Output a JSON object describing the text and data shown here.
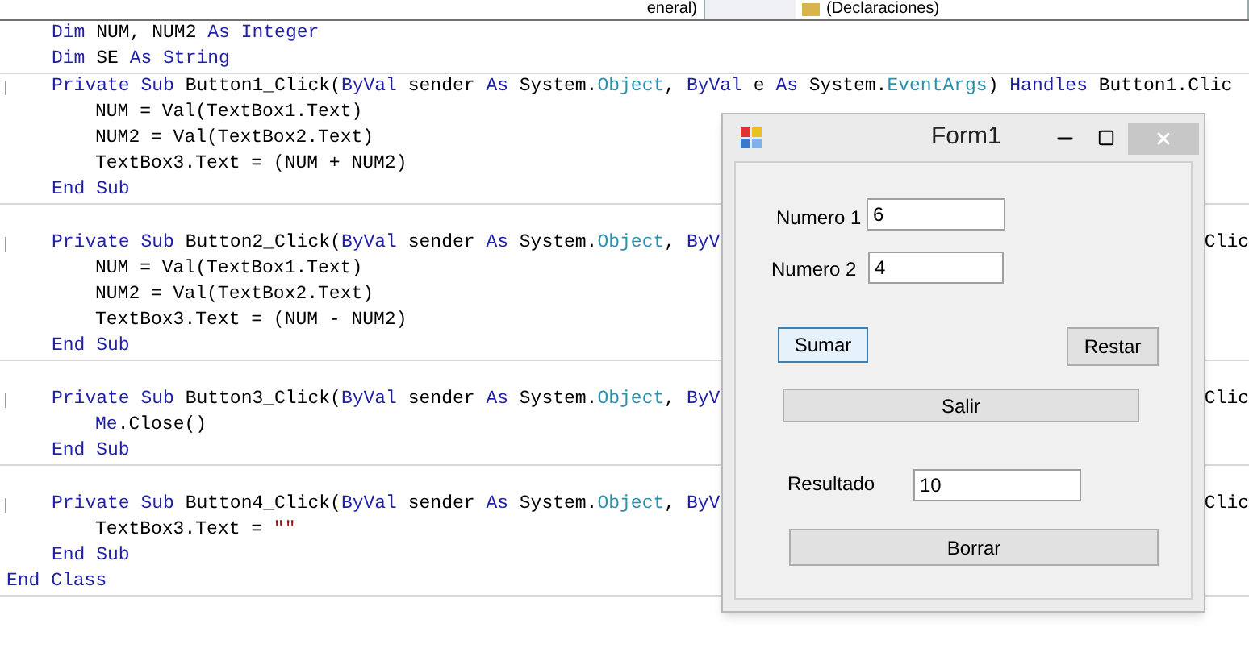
{
  "dropdowns": [
    {
      "label": "eneral)",
      "icon": false
    },
    {
      "label": "(Declaraciones)",
      "icon": true
    }
  ],
  "code_lines": [
    {
      "kind": "decl",
      "segments": [
        {
          "kind": "keyword",
          "text": "Dim"
        },
        {
          "kind": "plain",
          "text": " NUM, NUM2 "
        },
        {
          "kind": "keyword",
          "text": "As Integer"
        }
      ]
    },
    {
      "kind": "decl",
      "segments": [
        {
          "kind": "keyword",
          "text": "Dim"
        },
        {
          "kind": "plain",
          "text": " SE "
        },
        {
          "kind": "keyword",
          "text": "As String"
        }
      ]
    },
    {
      "kind": "rule"
    },
    {
      "kind": "sub",
      "segments": [
        {
          "kind": "keyword",
          "text": "Private Sub"
        },
        {
          "kind": "plain",
          "text": " Button1_Click("
        },
        {
          "kind": "keyword",
          "text": "ByVal"
        },
        {
          "kind": "plain",
          "text": " sender "
        },
        {
          "kind": "keyword",
          "text": "As"
        },
        {
          "kind": "plain",
          "text": " System."
        },
        {
          "kind": "type",
          "text": "Object"
        },
        {
          "kind": "plain",
          "text": ", "
        },
        {
          "kind": "keyword",
          "text": "ByVal"
        },
        {
          "kind": "plain",
          "text": " e "
        },
        {
          "kind": "keyword",
          "text": "As"
        },
        {
          "kind": "plain",
          "text": " System."
        },
        {
          "kind": "type",
          "text": "EventArgs"
        },
        {
          "kind": "plain",
          "text": ") "
        },
        {
          "kind": "keyword",
          "text": "Handles"
        },
        {
          "kind": "plain",
          "text": " Button1.Clic"
        }
      ]
    },
    {
      "kind": "body",
      "segments": [
        {
          "kind": "plain",
          "text": "NUM = Val(TextBox1.Text)"
        }
      ]
    },
    {
      "kind": "body",
      "segments": [
        {
          "kind": "plain",
          "text": "NUM2 = Val(TextBox2.Text)"
        }
      ]
    },
    {
      "kind": "body",
      "segments": [
        {
          "kind": "plain",
          "text": "TextBox3.Text = (NUM + NUM2)"
        }
      ]
    },
    {
      "kind": "end",
      "segments": [
        {
          "kind": "keyword",
          "text": "End Sub"
        }
      ]
    },
    {
      "kind": "rule"
    },
    {
      "kind": "blank"
    },
    {
      "kind": "sub",
      "segments": [
        {
          "kind": "keyword",
          "text": "Private Sub"
        },
        {
          "kind": "plain",
          "text": " Button2_Click("
        },
        {
          "kind": "keyword",
          "text": "ByVal"
        },
        {
          "kind": "plain",
          "text": " sender "
        },
        {
          "kind": "keyword",
          "text": "As"
        },
        {
          "kind": "plain",
          "text": " System."
        },
        {
          "kind": "type",
          "text": "Object"
        },
        {
          "kind": "plain",
          "text": ", "
        },
        {
          "kind": "keyword",
          "text": "ByV"
        }
      ],
      "tail": "Clic"
    },
    {
      "kind": "body",
      "segments": [
        {
          "kind": "plain",
          "text": "NUM = Val(TextBox1.Text)"
        }
      ]
    },
    {
      "kind": "body",
      "segments": [
        {
          "kind": "plain",
          "text": "NUM2 = Val(TextBox2.Text)"
        }
      ]
    },
    {
      "kind": "body",
      "segments": [
        {
          "kind": "plain",
          "text": "TextBox3.Text = (NUM - NUM2)"
        }
      ]
    },
    {
      "kind": "end",
      "segments": [
        {
          "kind": "keyword",
          "text": "End Sub"
        }
      ]
    },
    {
      "kind": "rule"
    },
    {
      "kind": "blank"
    },
    {
      "kind": "sub",
      "segments": [
        {
          "kind": "keyword",
          "text": "Private Sub"
        },
        {
          "kind": "plain",
          "text": " Button3_Click("
        },
        {
          "kind": "keyword",
          "text": "ByVal"
        },
        {
          "kind": "plain",
          "text": " sender "
        },
        {
          "kind": "keyword",
          "text": "As"
        },
        {
          "kind": "plain",
          "text": " System."
        },
        {
          "kind": "type",
          "text": "Object"
        },
        {
          "kind": "plain",
          "text": ", "
        },
        {
          "kind": "keyword",
          "text": "ByV"
        }
      ],
      "tail": "Clic"
    },
    {
      "kind": "body",
      "segments": [
        {
          "kind": "keyword",
          "text": "Me"
        },
        {
          "kind": "plain",
          "text": ".Close()"
        }
      ]
    },
    {
      "kind": "end",
      "segments": [
        {
          "kind": "keyword",
          "text": "End Sub"
        }
      ]
    },
    {
      "kind": "rule"
    },
    {
      "kind": "blank"
    },
    {
      "kind": "sub",
      "segments": [
        {
          "kind": "keyword",
          "text": "Private Sub"
        },
        {
          "kind": "plain",
          "text": " Button4_Click("
        },
        {
          "kind": "keyword",
          "text": "ByVal"
        },
        {
          "kind": "plain",
          "text": " sender "
        },
        {
          "kind": "keyword",
          "text": "As"
        },
        {
          "kind": "plain",
          "text": " System."
        },
        {
          "kind": "type",
          "text": "Object"
        },
        {
          "kind": "plain",
          "text": ", "
        },
        {
          "kind": "keyword",
          "text": "ByV"
        }
      ],
      "tail": "Clic"
    },
    {
      "kind": "body",
      "segments": [
        {
          "kind": "plain",
          "text": "TextBox3.Text = "
        },
        {
          "kind": "string",
          "text": "\"\""
        }
      ]
    },
    {
      "kind": "end",
      "segments": [
        {
          "kind": "keyword",
          "text": "End Sub"
        }
      ]
    },
    {
      "kind": "class_end",
      "segments": [
        {
          "kind": "keyword",
          "text": "End Class"
        }
      ]
    },
    {
      "kind": "rule"
    }
  ],
  "form": {
    "title": "Form1",
    "controls": [
      {
        "kind": "label",
        "text": "Numero 1"
      },
      {
        "kind": "textbox",
        "value": "6"
      },
      {
        "kind": "label",
        "text": "Numero 2"
      },
      {
        "kind": "textbox",
        "value": "4"
      },
      {
        "kind": "button",
        "text": "Sumar",
        "focused": true
      },
      {
        "kind": "button",
        "text": "Restar",
        "focused": false
      },
      {
        "kind": "button",
        "text": "Salir",
        "focused": false
      },
      {
        "kind": "label",
        "text": "Resultado"
      },
      {
        "kind": "textbox",
        "value": "10"
      },
      {
        "kind": "button",
        "text": "Borrar",
        "focused": false
      }
    ]
  }
}
